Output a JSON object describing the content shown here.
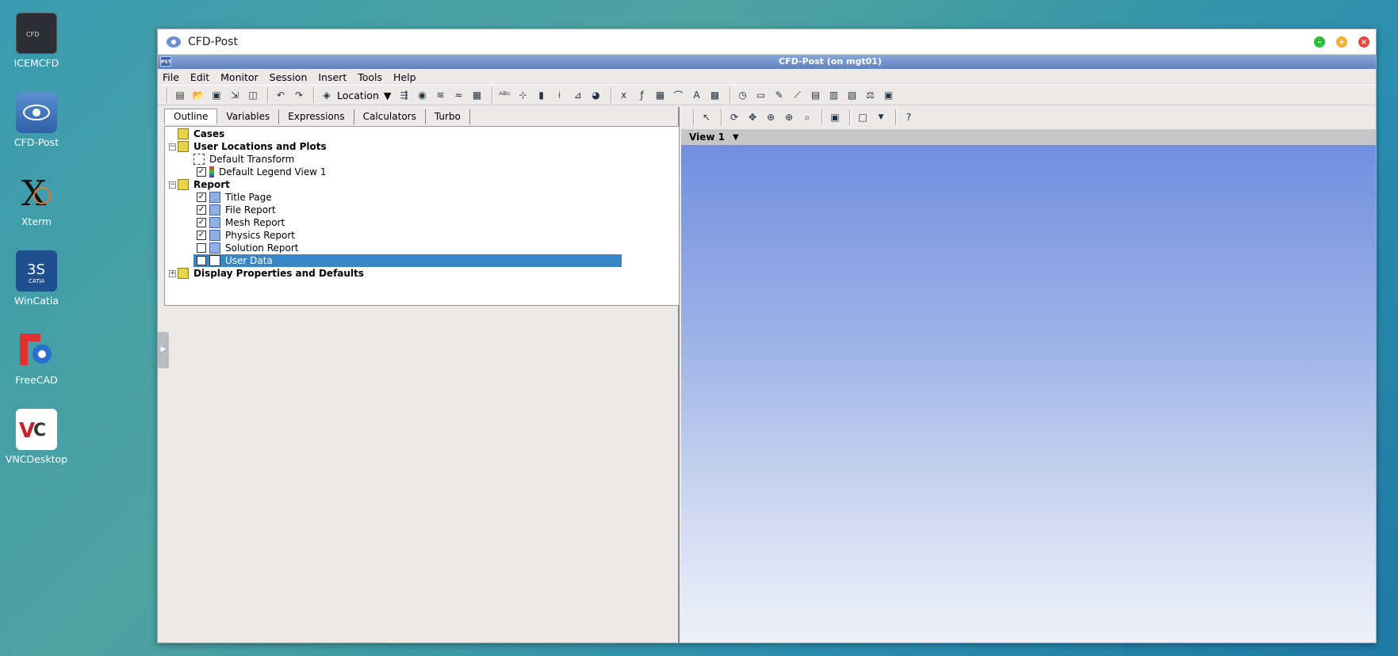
{
  "desktop": {
    "icons": [
      {
        "label": "ICEMCFD",
        "name": "icemcfd"
      },
      {
        "label": "CFD-Post",
        "name": "cfd-post"
      },
      {
        "label": "Xterm",
        "name": "xterm"
      },
      {
        "label": "WinCatia",
        "name": "wincatia"
      },
      {
        "label": "FreeCAD",
        "name": "freecad"
      },
      {
        "label": "VNCDesktop",
        "name": "vncdesktop"
      }
    ]
  },
  "window": {
    "title": "CFD-Post",
    "inner_title": "CFD-Post (on mgt01)",
    "inner_badge": "PST",
    "colors": {
      "minimize": "#2cbf3c",
      "maximize": "#f2b233",
      "close": "#e8433d"
    }
  },
  "menu": [
    "File",
    "Edit",
    "Monitor",
    "Session",
    "Insert",
    "Tools",
    "Help"
  ],
  "toolbar": {
    "location_label": "Location"
  },
  "tabs": [
    "Outline",
    "Variables",
    "Expressions",
    "Calculators",
    "Turbo"
  ],
  "tree": {
    "cases": "Cases",
    "user_locations": "User Locations and Plots",
    "default_transform": "Default Transform",
    "default_legend": "Default Legend View 1",
    "report": "Report",
    "title_page": "Title Page",
    "file_report": "File Report",
    "mesh_report": "Mesh Report",
    "physics_report": "Physics Report",
    "solution_report": "Solution Report",
    "user_data": "User Data",
    "display_props": "Display Properties and Defaults"
  },
  "view": {
    "label": "View 1"
  }
}
